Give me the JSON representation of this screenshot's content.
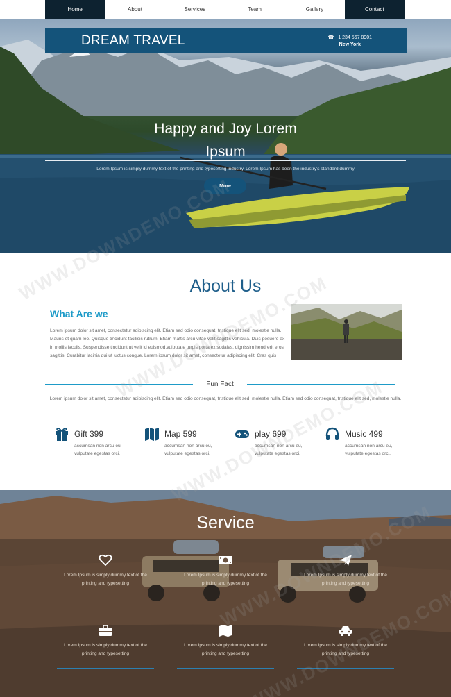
{
  "nav": {
    "items": [
      {
        "label": "Home",
        "active": true
      },
      {
        "label": "About",
        "active": false
      },
      {
        "label": "Services",
        "active": false
      },
      {
        "label": "Team",
        "active": false
      },
      {
        "label": "Gallery",
        "active": false
      },
      {
        "label": "Contact",
        "active": true
      }
    ]
  },
  "hero": {
    "brand": "DREAM TRAVEL",
    "phone": "☎ +1 234 567 8901",
    "city": "New York",
    "title_line1": "Happy and Joy Lorem",
    "title_line2": "Ipsum",
    "subtitle": "Lorem Ipsum is simply dummy text of the printing and typesetting industry. Lorem Ipsum has been the industry's standard dummy",
    "button": "More"
  },
  "about": {
    "title": "About Us",
    "subtitle": "What Are we",
    "text": "Lorem ipsum dolor sit amet, consectetur adipiscing elit. Etiam sed odio consequat, tristique elit sed, molestie nulla. Mauris et quam leo. Quisque tincidunt facilisis rutrum. Etiam mattis arcu vitae velit sagittis vehicula. Duis posuere ex in mollis iaculis. Suspendisse tincidunt ut velit id euismod.vulputate turpis porta ex sodales, dignissim hendrerit eros sagittis. Curabitur lacinia dui ut luctus congue. Lorem ipsum dolor sit amet, consectetur adipiscing elit. Cras quis",
    "fun_title": "Fun Fact",
    "fun_text": "Lorem ipsum dolor sit amet, consectetur adipiscing elit. Etiam sed odio consequat, tristique elit sed, molestie nulla. Etiam sed odio consequat, tristique elit sed, molestie nulla.",
    "facts": [
      {
        "icon": "gift-icon",
        "label": "Gift 399",
        "desc": "accumsan non arcu eu, vulputate egestas orci."
      },
      {
        "icon": "map-icon",
        "label": "Map 599",
        "desc": "accumsan non arcu eu, vulputate egestas orci."
      },
      {
        "icon": "gamepad-icon",
        "label": "play 699",
        "desc": "accumsan non arcu eu, vulputate egestas orci."
      },
      {
        "icon": "headphones-icon",
        "label": "Music 499",
        "desc": "accumsan non arcu eu, vulputate egestas orci."
      }
    ]
  },
  "service": {
    "title": "Service",
    "items": [
      {
        "icon": "heart-icon",
        "text": "Lorem Ipsum is simply dummy text of the printing and typesetting"
      },
      {
        "icon": "money-icon",
        "text": "Lorem Ipsum is simply dummy text of the printing and typesetting"
      },
      {
        "icon": "send-icon",
        "text": "Lorem Ipsum is simply dummy text of the printing and typesetting"
      },
      {
        "icon": "briefcase-icon",
        "text": "Lorem Ipsum is simply dummy text of the printing and typesetting"
      },
      {
        "icon": "map-icon",
        "text": "Lorem Ipsum is simply dummy text of the printing and typesetting"
      },
      {
        "icon": "car-icon",
        "text": "Lorem Ipsum is simply dummy text of the printing and typesetting"
      }
    ]
  },
  "watermark": "WWW.DOWNDEMO.COM",
  "colors": {
    "brand_blue": "#14537a",
    "accent_cyan": "#1e9bc8",
    "nav_dark": "#0d2230",
    "heading_blue": "#1f5f8b"
  }
}
